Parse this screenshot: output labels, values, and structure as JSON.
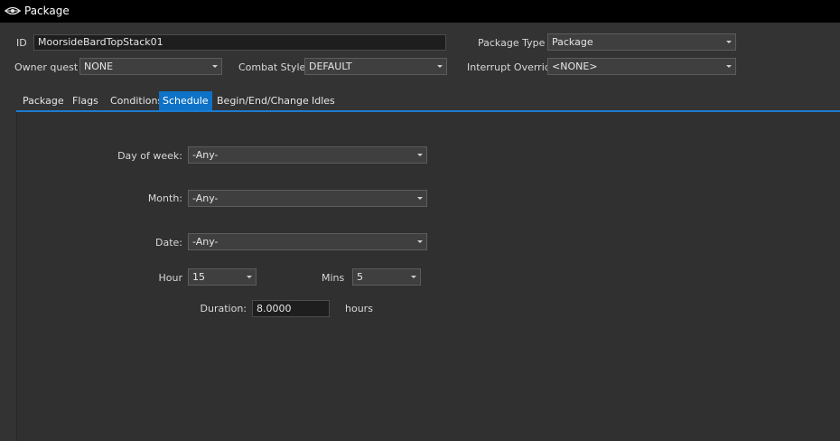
{
  "window": {
    "title": "Package",
    "icon": "eye-icon"
  },
  "header": {
    "id_label": "ID",
    "id_value": "MoorsideBardTopStack01",
    "package_type_label": "Package Type",
    "package_type_value": "Package",
    "owner_quest_label": "Owner quest",
    "owner_quest_value": "NONE",
    "combat_style_label": "Combat Style",
    "combat_style_value": "DEFAULT",
    "interrupt_override_label": "Interrupt Override",
    "interrupt_override_value": "<NONE>"
  },
  "tabs": [
    {
      "label": "Package"
    },
    {
      "label": "Flags"
    },
    {
      "label": "Conditions"
    },
    {
      "label": "Schedule",
      "active": true
    },
    {
      "label": "Begin/End/Change"
    },
    {
      "label": "Idles"
    }
  ],
  "schedule": {
    "day_of_week_label": "Day of week:",
    "day_of_week_value": "-Any-",
    "month_label": "Month:",
    "month_value": "-Any-",
    "date_label": "Date:",
    "date_value": "-Any-",
    "hour_label": "Hour",
    "hour_value": "15",
    "mins_label": "Mins",
    "mins_value": "5",
    "duration_label": "Duration:",
    "duration_value": "8.0000",
    "duration_unit": "hours"
  },
  "colors": {
    "accent": "#0e72c6",
    "background": "#333333",
    "titlebar": "#000000"
  }
}
